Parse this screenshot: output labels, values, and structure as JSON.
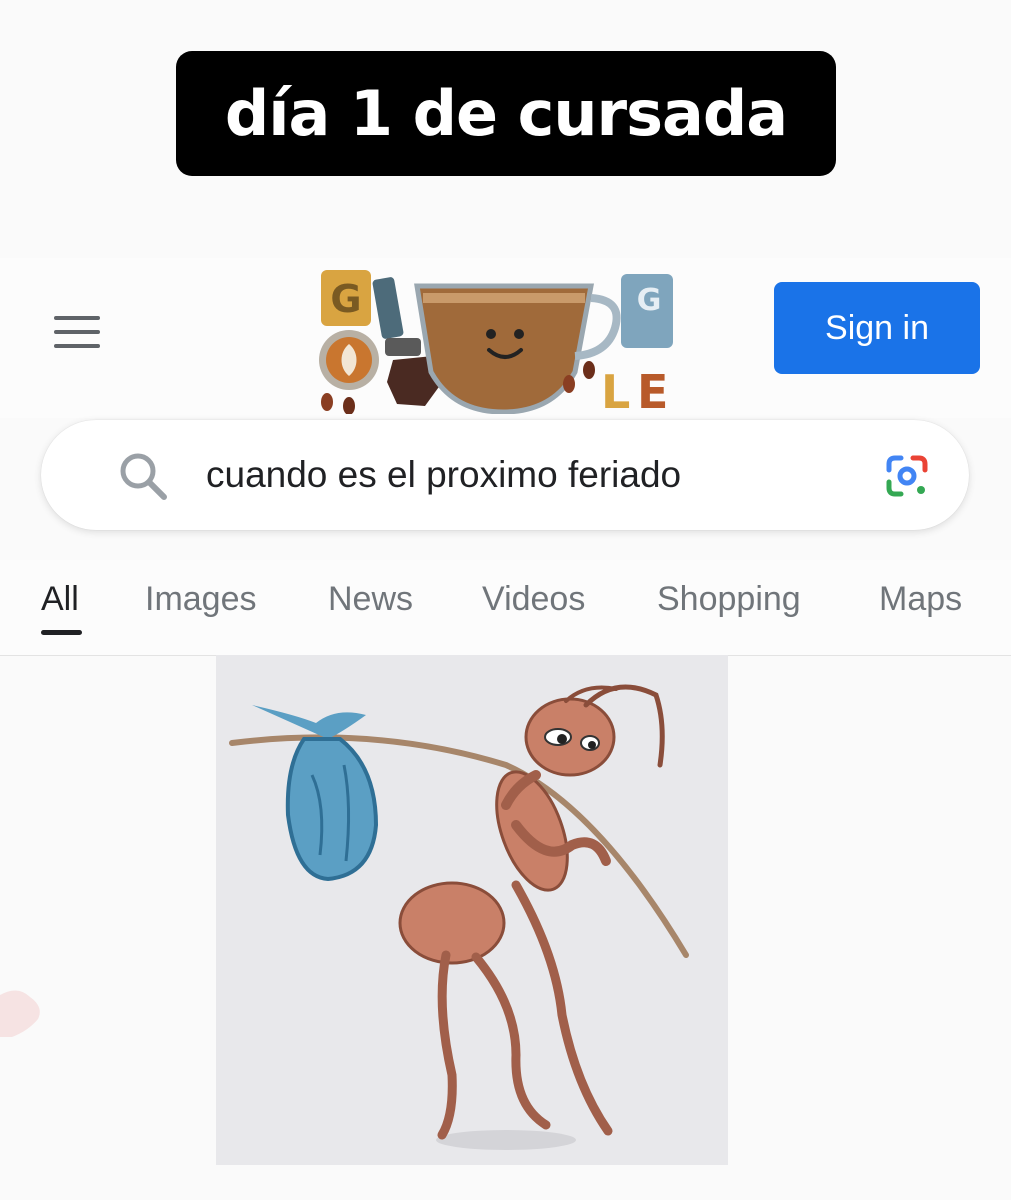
{
  "caption": {
    "text": "día 1 de cursada"
  },
  "header": {
    "menu_icon": "hamburger-menu-icon",
    "logo_icon": "google-coffee-doodle-logo",
    "sign_in_label": "Sign in",
    "sign_in_color": "#1a73e8"
  },
  "search": {
    "query": "cuando es el proximo feriado",
    "search_icon": "search-icon",
    "lens_icon": "google-lens-icon"
  },
  "tabs": [
    {
      "label": "All",
      "active": true
    },
    {
      "label": "Images",
      "active": false
    },
    {
      "label": "News",
      "active": false
    },
    {
      "label": "Videos",
      "active": false
    },
    {
      "label": "Shopping",
      "active": false
    },
    {
      "label": "Maps",
      "active": false
    }
  ],
  "result": {
    "image_icon": "ant-with-bindle-illustration",
    "colors": {
      "ant": "#c98068",
      "bundle": "#5b9fc4"
    }
  }
}
